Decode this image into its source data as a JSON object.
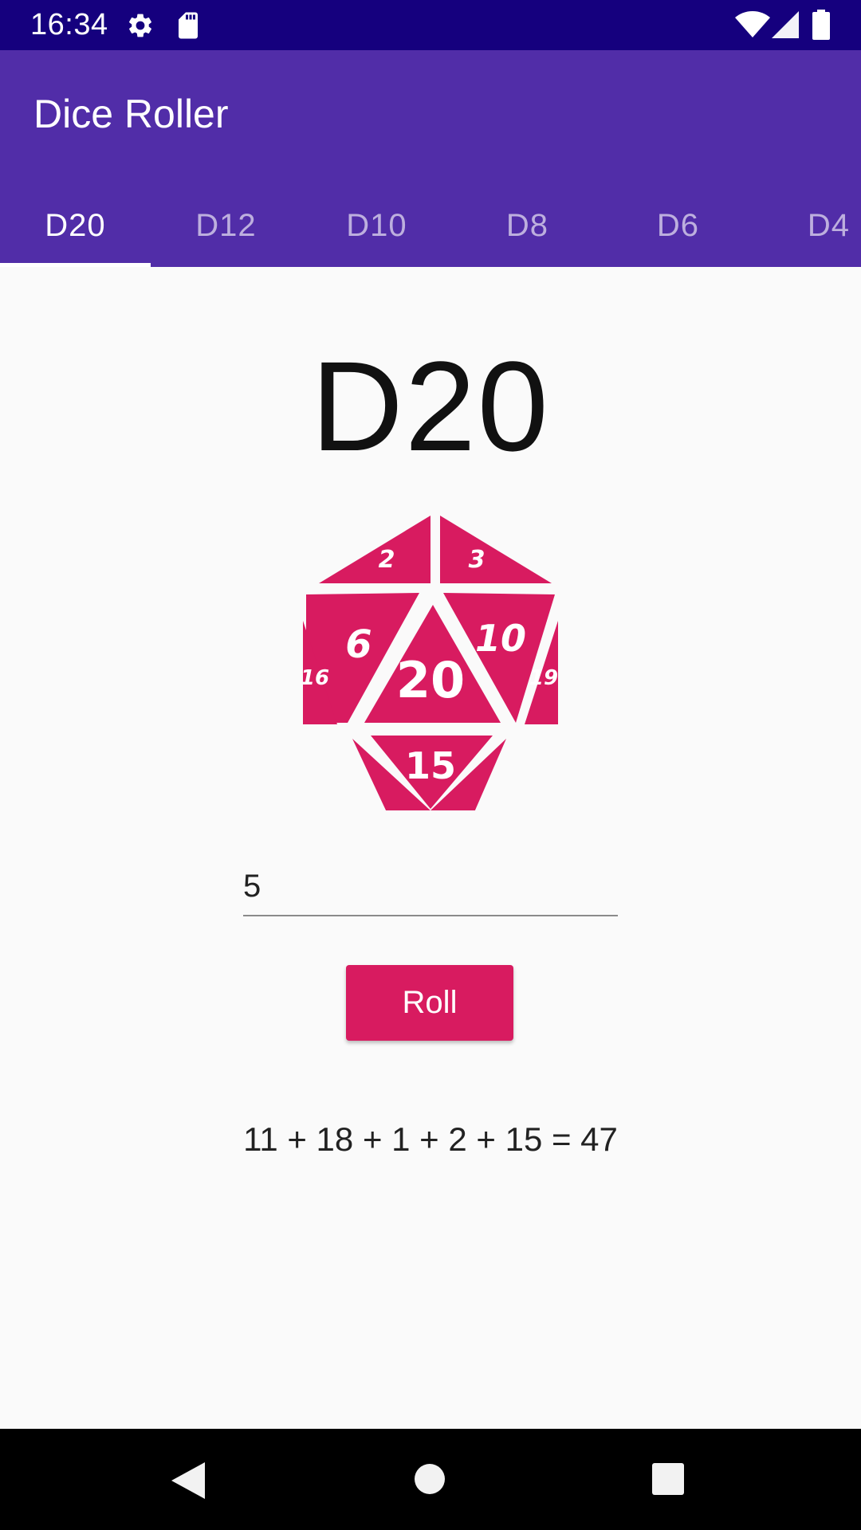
{
  "status_bar": {
    "time": "16:34",
    "icons": [
      "gear-icon",
      "sd-card-icon",
      "wifi-icon",
      "signal-icon",
      "battery-icon"
    ]
  },
  "app_bar": {
    "title": "Dice Roller",
    "tabs": [
      {
        "label": "D20",
        "selected": true
      },
      {
        "label": "D12",
        "selected": false
      },
      {
        "label": "D10",
        "selected": false
      },
      {
        "label": "D8",
        "selected": false
      },
      {
        "label": "D6",
        "selected": false
      },
      {
        "label": "D4",
        "selected": false
      }
    ]
  },
  "main": {
    "die_title": "D20",
    "die_image": {
      "icon": "d20-die-icon",
      "faces": [
        "2",
        "3",
        "6",
        "10",
        "20",
        "16",
        "19",
        "15"
      ]
    },
    "count_field": {
      "value": "5"
    },
    "roll_button_label": "Roll",
    "result_text": "11 + 18 + 1 + 2 + 15 = 47"
  },
  "navigation_bar": {
    "buttons": [
      "back-icon",
      "home-icon",
      "recents-icon"
    ]
  },
  "colors": {
    "status_bar": "#15007e",
    "primary": "#512da8",
    "accent": "#d81b60",
    "background": "#fafafa"
  }
}
